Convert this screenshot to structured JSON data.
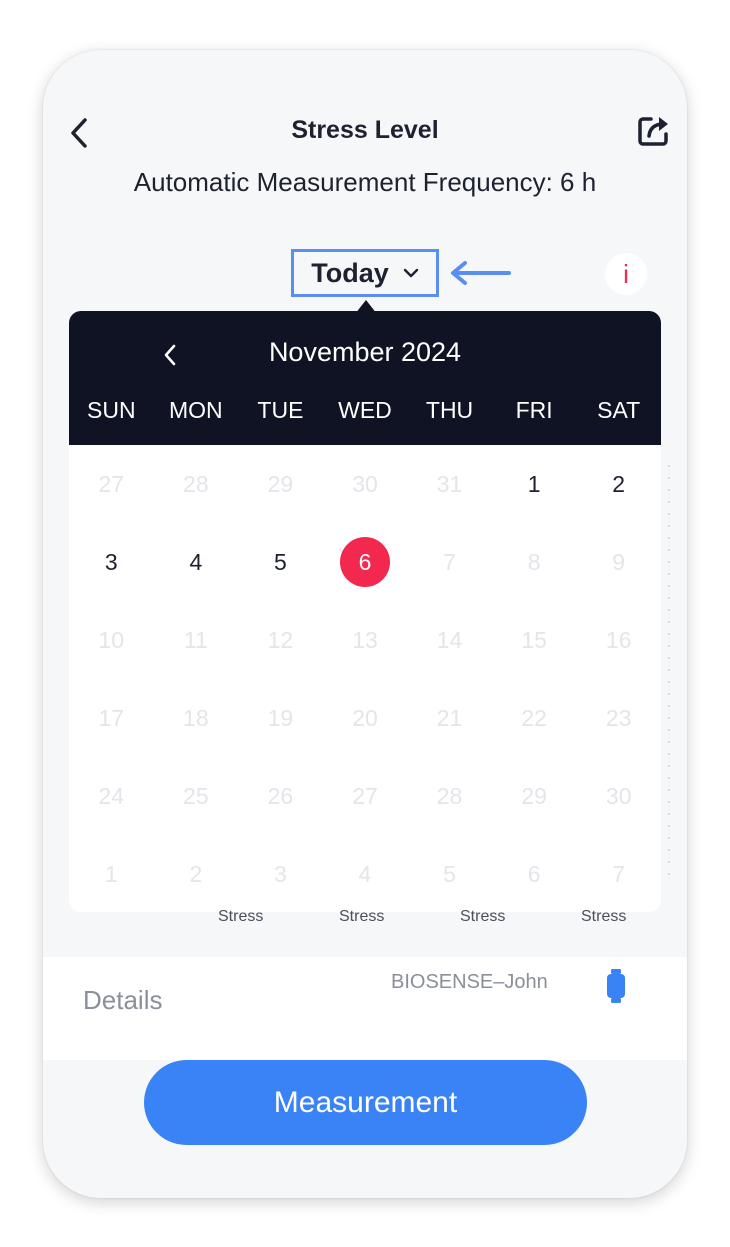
{
  "header": {
    "title": "Stress Level",
    "back_icon": "chevron-left-icon",
    "share_icon": "share-icon",
    "frequency_text": "Automatic Measurement Frequency: 6 h"
  },
  "date_selector": {
    "label": "Today",
    "dropdown_icon": "chevron-down-icon",
    "info_label": "i"
  },
  "calendar": {
    "month_label": "November 2024",
    "weekdays": [
      "SUN",
      "MON",
      "TUE",
      "WED",
      "THU",
      "FRI",
      "SAT"
    ],
    "days": [
      {
        "label": "27",
        "muted": true
      },
      {
        "label": "28",
        "muted": true
      },
      {
        "label": "29",
        "muted": true
      },
      {
        "label": "30",
        "muted": true
      },
      {
        "label": "31",
        "muted": true
      },
      {
        "label": "1",
        "muted": false
      },
      {
        "label": "2",
        "muted": false
      },
      {
        "label": "3",
        "muted": false
      },
      {
        "label": "4",
        "muted": false
      },
      {
        "label": "5",
        "muted": false
      },
      {
        "label": "6",
        "muted": false,
        "selected": true
      },
      {
        "label": "7",
        "muted": true
      },
      {
        "label": "8",
        "muted": true
      },
      {
        "label": "9",
        "muted": true
      },
      {
        "label": "10",
        "muted": true
      },
      {
        "label": "11",
        "muted": true
      },
      {
        "label": "12",
        "muted": true
      },
      {
        "label": "13",
        "muted": true
      },
      {
        "label": "14",
        "muted": true
      },
      {
        "label": "15",
        "muted": true
      },
      {
        "label": "16",
        "muted": true
      },
      {
        "label": "17",
        "muted": true
      },
      {
        "label": "18",
        "muted": true
      },
      {
        "label": "19",
        "muted": true
      },
      {
        "label": "20",
        "muted": true
      },
      {
        "label": "21",
        "muted": true
      },
      {
        "label": "22",
        "muted": true
      },
      {
        "label": "23",
        "muted": true
      },
      {
        "label": "24",
        "muted": true
      },
      {
        "label": "25",
        "muted": true
      },
      {
        "label": "26",
        "muted": true
      },
      {
        "label": "27",
        "muted": true
      },
      {
        "label": "28",
        "muted": true
      },
      {
        "label": "29",
        "muted": true
      },
      {
        "label": "30",
        "muted": true
      },
      {
        "label": "1",
        "muted": true
      },
      {
        "label": "2",
        "muted": true
      },
      {
        "label": "3",
        "muted": true
      },
      {
        "label": "4",
        "muted": true
      },
      {
        "label": "5",
        "muted": true
      },
      {
        "label": "6",
        "muted": true
      },
      {
        "label": "7",
        "muted": true
      }
    ]
  },
  "stress_labels": [
    "Stress",
    "Stress",
    "Stress",
    "Stress"
  ],
  "details": {
    "label": "Details",
    "device_name": "BIOSENSE–John",
    "device_icon": "watch-icon"
  },
  "measure_button": "Measurement",
  "colors": {
    "accent": "#3a83f7",
    "selected_day": "#f2284f",
    "calendar_header": "#0f1324",
    "annotation": "#5b8ef1"
  }
}
